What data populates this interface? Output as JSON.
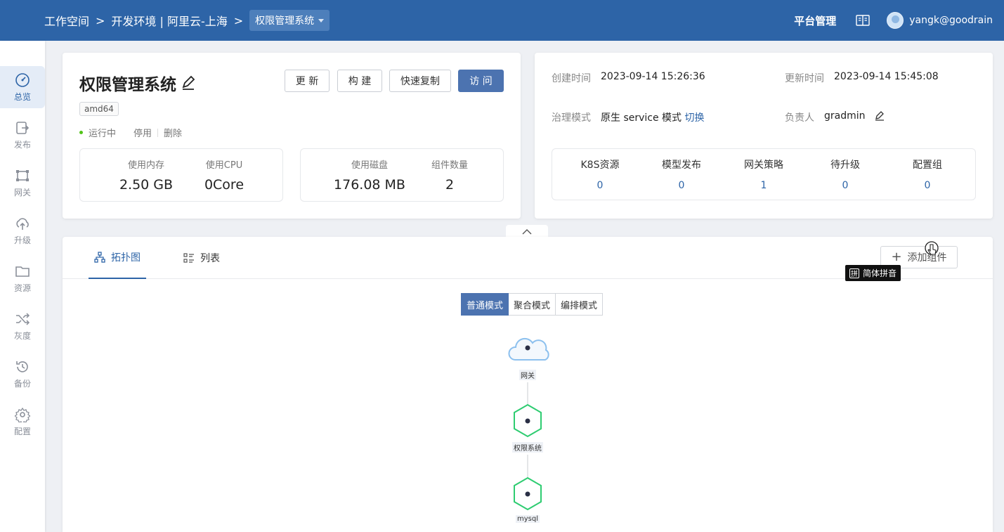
{
  "header": {
    "breadcrumbs": [
      "工作空间",
      "开发环境 | 阿里云-上海"
    ],
    "separator": ">",
    "current_app": "权限管理系统",
    "platform_label": "平台管理",
    "username": "yangk@goodrain"
  },
  "sidebar": {
    "items": [
      {
        "label": "总览",
        "icon": "dashboard-icon",
        "active": true
      },
      {
        "label": "发布",
        "icon": "publish-icon",
        "active": false
      },
      {
        "label": "网关",
        "icon": "gateway-icon",
        "active": false
      },
      {
        "label": "升级",
        "icon": "upgrade-icon",
        "active": false
      },
      {
        "label": "资源",
        "icon": "folder-icon",
        "active": false
      },
      {
        "label": "灰度",
        "icon": "shuffle-icon",
        "active": false
      },
      {
        "label": "备份",
        "icon": "history-icon",
        "active": false
      },
      {
        "label": "配置",
        "icon": "gear-icon",
        "active": false
      }
    ]
  },
  "app_card": {
    "title": "权限管理系统",
    "buttons": {
      "update": "更 新",
      "build": "构 建",
      "copy": "快速复制",
      "visit": "访 问"
    },
    "arch_tag": "amd64",
    "status": "运行中",
    "stop": "停用",
    "delete": "删除",
    "stats": [
      {
        "label": "使用内存",
        "value": "2.50 GB"
      },
      {
        "label": "使用CPU",
        "value": "0Core"
      },
      {
        "label": "使用磁盘",
        "value": "176.08 MB"
      },
      {
        "label": "组件数量",
        "value": "2"
      }
    ]
  },
  "info_card": {
    "created_label": "创建时间",
    "created_value": "2023-09-14 15:26:36",
    "updated_label": "更新时间",
    "updated_value": "2023-09-14 15:45:08",
    "governance_label": "治理模式",
    "governance_value": "原生 service 模式",
    "switch_label": "切换",
    "owner_label": "负责人",
    "owner_value": "gradmin",
    "resources": [
      {
        "label": "K8S资源",
        "value": "0"
      },
      {
        "label": "模型发布",
        "value": "0"
      },
      {
        "label": "网关策略",
        "value": "1"
      },
      {
        "label": "待升级",
        "value": "0"
      },
      {
        "label": "配置组",
        "value": "0"
      }
    ]
  },
  "panel": {
    "tabs": [
      {
        "label": "拓扑图",
        "icon": "topology-icon",
        "active": true
      },
      {
        "label": "列表",
        "icon": "list-icon",
        "active": false
      }
    ],
    "add_component": "添加组件",
    "ime_tooltip": "简体拼音",
    "ime_glyph": "拼",
    "modes": [
      {
        "label": "普通模式",
        "active": true
      },
      {
        "label": "聚合模式",
        "active": false
      },
      {
        "label": "编排模式",
        "active": false
      }
    ],
    "topology": {
      "nodes": [
        {
          "label": "网关",
          "type": "cloud"
        },
        {
          "label": "权限系统",
          "type": "service"
        },
        {
          "label": "mysql",
          "type": "service"
        }
      ]
    }
  },
  "colors": {
    "brand": "#2d64a7",
    "primary_button": "#4c73b0",
    "running": "#52c41a",
    "node_green": "#2ecc71"
  }
}
